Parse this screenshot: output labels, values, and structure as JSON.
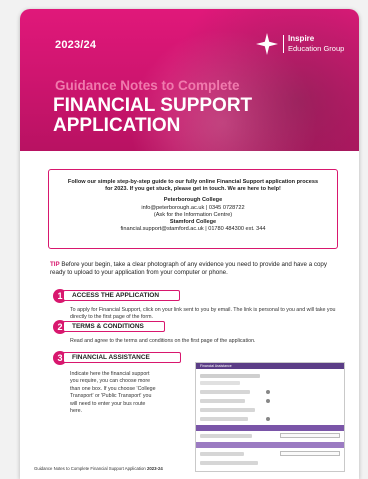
{
  "header": {
    "year": "2023/24",
    "logo_name": "Inspire",
    "logo_subtitle": "Education Group",
    "title_line1": "Guidance Notes to Complete",
    "title_line2": "FINANCIAL SUPPORT APPLICATION"
  },
  "intro": {
    "text": "Follow our simple step-by-step guide to our fully online Financial Support application process for 2023. If you get stuck, please get in touch. We are here to help!",
    "college1_name": "Peterborough College",
    "college1_contact": "info@peterborough.ac.uk | 0345 0728722",
    "college1_note": "(Ask for the Information Centre)",
    "college2_name": "Stamford College",
    "college2_contact": "financial.support@stamford.ac.uk | 01780 484300 ext. 344"
  },
  "tip": {
    "label": "TIP",
    "text": " Before your begin, take a clear photograph of any evidence you need to provide and have a copy ready to upload to your application from your computer or phone."
  },
  "steps": [
    {
      "number": "1",
      "title": "ACCESS THE APPLICATION",
      "text": "To apply for Financial Support, click on your link sent to you by email. The link is personal to you and will take you directly to the first page of the form."
    },
    {
      "number": "2",
      "title": "TERMS & CONDITIONS",
      "text": "Read and agree to the terms and conditions on the first page of the application."
    },
    {
      "number": "3",
      "title": "FINANCIAL ASSISTANCE",
      "text": "Indicate here the financial support you require, you can choose more than one box. If you choose 'College Transport' or 'Public Transport' you will need to enter your bus route here."
    }
  ],
  "form_preview": {
    "header": "Financial Assistance"
  },
  "footer": {
    "text": "Guidance Notes to Complete Financial Support Application ",
    "year": "2023-24"
  },
  "colors": {
    "brand_pink": "#d8176e",
    "title_pink": "#f07aad",
    "form_purple": "#7a55a8"
  }
}
